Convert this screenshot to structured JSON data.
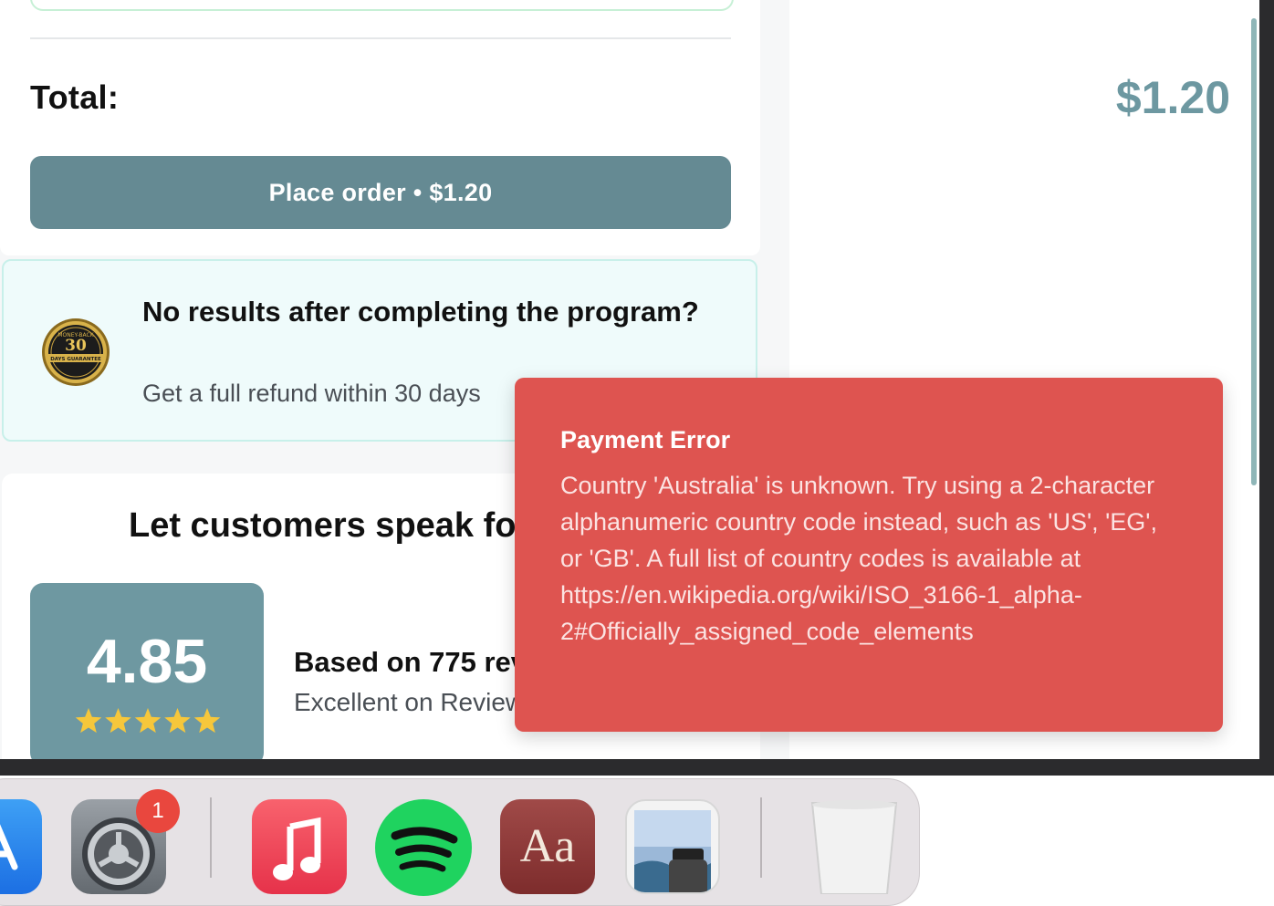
{
  "order": {
    "total_label": "Total:",
    "total_value": "$1.20",
    "place_order_label": "Place order • $1.20"
  },
  "guarantee": {
    "badge_top_text": "MONEY-BACK",
    "badge_number": "30",
    "badge_bottom_text": "DAYS GUARANTEE",
    "title": "No results after completing the program?",
    "subtitle": "Get a full refund within 30 days"
  },
  "reviews": {
    "heading": "Let customers speak for us",
    "rating": "4.85",
    "stars": 5,
    "based_on": "Based on 775 reviews",
    "excellent_on": "Excellent on Reviews.io"
  },
  "error_toast": {
    "title": "Payment Error",
    "message": "Country 'Australia' is unknown. Try using a 2-character alphanumeric country code instead, such as 'US', 'EG', or 'GB'. A full list of country codes is available at https://en.wikipedia.org/wiki/ISO_3166-1_alpha-2#Officially_assigned_code_elements"
  },
  "dock": {
    "apps": [
      {
        "name": "App Store",
        "icon": "app-store-icon"
      },
      {
        "name": "System Settings",
        "icon": "settings-icon",
        "badge": "1"
      },
      {
        "name": "Music",
        "icon": "music-icon"
      },
      {
        "name": "Spotify",
        "icon": "spotify-icon"
      },
      {
        "name": "Dictionary",
        "icon": "dictionary-icon",
        "label": "Aa"
      },
      {
        "name": "Preview",
        "icon": "preview-icon"
      },
      {
        "name": "Trash",
        "icon": "trash-icon"
      }
    ]
  },
  "colors": {
    "accent": "#658a93",
    "total_value": "#6d98a1",
    "rating_box": "#6e98a1",
    "error": "#de5450",
    "guarantee_bg": "#effbfb",
    "stars": "#f6c73b"
  }
}
